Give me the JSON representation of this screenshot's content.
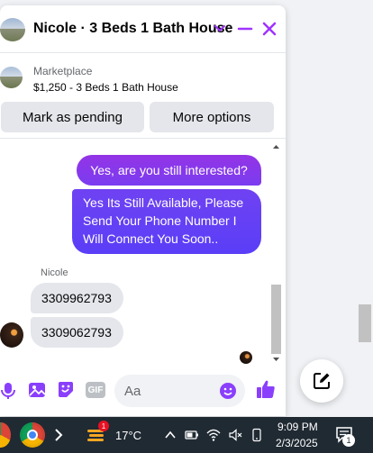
{
  "header": {
    "title": "Nicole · 3 Beds 1 Bath House",
    "accent": "#a033ff"
  },
  "marketplace": {
    "label": "Marketplace",
    "listing": "$1,250 - 3 Beds 1 Bath House"
  },
  "actions": {
    "pending_label": "Mark as pending",
    "more_label": "More options"
  },
  "messages": {
    "outgoing": [
      "Yes, are you still interested?",
      "Yes Its Still Available, Please Send Your Phone Number I Will Connect You Soon.."
    ],
    "sender_name": "Nicole",
    "incoming": [
      "3309962793",
      "3309062793"
    ]
  },
  "composer": {
    "placeholder": "Aa",
    "icons": [
      "microphone-icon",
      "image-icon",
      "sticker-icon",
      "gif-icon",
      "emoji-icon",
      "like-icon"
    ],
    "gif_label": "GIF"
  },
  "taskbar": {
    "temperature": "17°C",
    "weather_badge": "1",
    "time": "9:09 PM",
    "date": "2/3/2025",
    "notification_count": "1"
  }
}
